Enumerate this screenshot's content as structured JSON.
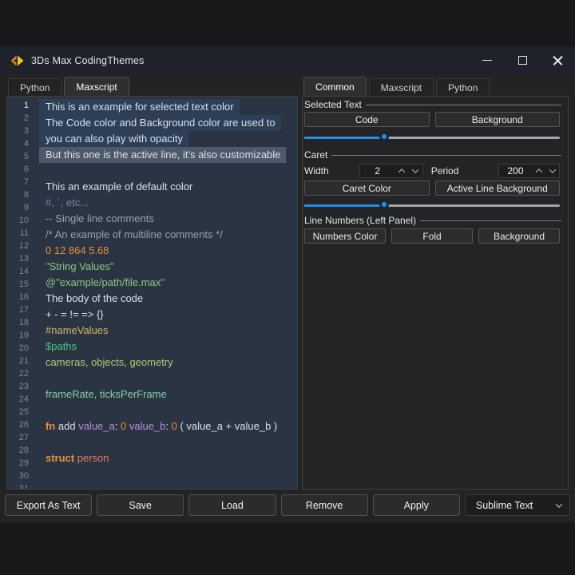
{
  "colors": {
    "accent": "#1f8fe8",
    "editor_bg": "#2b3442",
    "selection_bg": "#2d3f56",
    "active_line_bg": "#4e5a6a",
    "line_number": "#7e8894",
    "line_number_active": "#eaf0f6",
    "icon_orange": "#d8831f",
    "icon_yellow": "#f2c21d",
    "syntax": {
      "default": "#d9e0e8",
      "dim_blue": "#6d89ab",
      "comment": "#97a2ac",
      "number": "#e2913c",
      "string": "#8bc87e",
      "name_literal": "#d3b962",
      "path_literal": "#43cf78",
      "global_objects": "#a9cd6e",
      "global_props": "#7fd2a1",
      "keyword": "#ee8e3b",
      "param": "#b78fdd",
      "struct_name": "#e3795c"
    }
  },
  "window": {
    "title": "3Ds Max CodingThemes"
  },
  "editor": {
    "tabs": [
      {
        "label": "Python",
        "active": false
      },
      {
        "label": "Maxscript",
        "active": true
      }
    ],
    "gutter_count": 31,
    "lines": [
      {
        "bg": "selection",
        "segs": [
          [
            "This is an example for selected text color",
            "default"
          ]
        ]
      },
      {
        "bg": "selection",
        "segs": [
          [
            "The Code color and Background color are used to",
            "default"
          ]
        ]
      },
      {
        "bg": "selection",
        "segs": [
          [
            "you can also play with opacity",
            "default"
          ]
        ]
      },
      {
        "bg": "active",
        "segs": [
          [
            "But this one is the active line, it's also customizable",
            "default"
          ]
        ]
      },
      {
        "segs": []
      },
      {
        "segs": [
          [
            "This an example of default color",
            "default"
          ]
        ]
      },
      {
        "segs": [
          [
            "#, `, etc...",
            "dim_blue"
          ]
        ]
      },
      {
        "segs": [
          [
            "-- Single line comments",
            "comment"
          ]
        ]
      },
      {
        "segs": [
          [
            "/* An example of multiline comments */",
            "comment"
          ]
        ]
      },
      {
        "segs": [
          [
            "0 12 864 5.68",
            "number"
          ]
        ]
      },
      {
        "segs": [
          [
            "\"String Values\"",
            "string"
          ]
        ]
      },
      {
        "segs": [
          [
            "@\"example/path/file.max\"",
            "string"
          ]
        ]
      },
      {
        "segs": [
          [
            "The body of the code",
            "default"
          ]
        ]
      },
      {
        "segs": [
          [
            "+ - = != => {}",
            "default"
          ]
        ]
      },
      {
        "segs": [
          [
            "#nameValues",
            "name_literal"
          ]
        ]
      },
      {
        "segs": [
          [
            "$paths",
            "path_literal"
          ]
        ]
      },
      {
        "segs": [
          [
            "cameras, objects, geometry",
            "global_objects"
          ]
        ]
      },
      {
        "segs": []
      },
      {
        "segs": [
          [
            "frameRate, ticksPerFrame",
            "global_props"
          ]
        ]
      },
      {
        "segs": []
      },
      {
        "segs": [
          [
            "fn",
            "keyword",
            true
          ],
          [
            " add ",
            "default"
          ],
          [
            "value_a",
            "param"
          ],
          [
            ": ",
            "default"
          ],
          [
            "0",
            "number"
          ],
          [
            " ",
            "default"
          ],
          [
            "value_b",
            "param"
          ],
          [
            ": ",
            "default"
          ],
          [
            "0",
            "number"
          ],
          [
            " ( value_a + value_b )",
            "default"
          ]
        ]
      },
      {
        "segs": []
      },
      {
        "segs": [
          [
            "struct",
            "keyword",
            true
          ],
          [
            " person",
            "struct_name"
          ]
        ]
      },
      {
        "segs": []
      }
    ]
  },
  "panel": {
    "tabs": [
      {
        "label": "Common",
        "active": true
      },
      {
        "label": "Maxscript",
        "active": false
      },
      {
        "label": "Python",
        "active": false
      }
    ],
    "selected_text": {
      "label": "Selected Text",
      "buttons": [
        "Code",
        "Background"
      ],
      "slider_percent": 32
    },
    "caret": {
      "label": "Caret",
      "width_label": "Width",
      "width_value": "2",
      "period_label": "Period",
      "period_value": "200",
      "buttons": [
        "Caret Color",
        "Active Line Background"
      ],
      "slider_percent": 32
    },
    "line_numbers": {
      "label": "Line Numbers (Left Panel)",
      "buttons": [
        "Numbers Color",
        "Fold",
        "Background"
      ]
    }
  },
  "footer": {
    "buttons": [
      "Export As Text",
      "Save",
      "Load",
      "Remove",
      "Apply"
    ],
    "theme_dropdown": "Sublime Text"
  }
}
